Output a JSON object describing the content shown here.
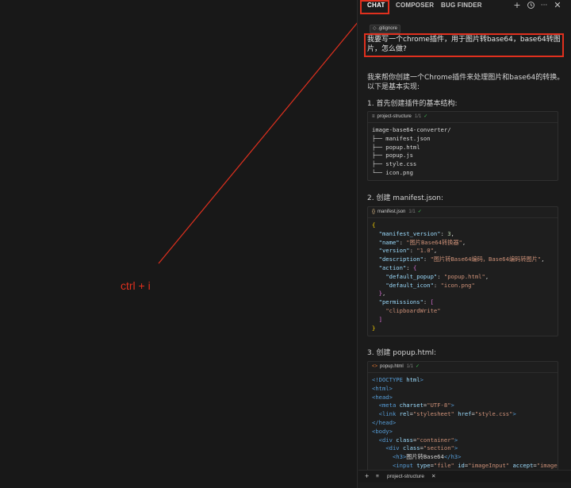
{
  "annotation": {
    "shortcut_label": "ctrl + i",
    "color": "#e0301e"
  },
  "topbar": {
    "tabs": [
      "CHAT",
      "COMPOSER",
      "BUG FINDER"
    ],
    "icons": [
      "plus-icon",
      "history-icon",
      "more-icon",
      "close-icon"
    ]
  },
  "context_chip": {
    "icon": "diamond-icon",
    "label": ".gitignore"
  },
  "user_message": "我要写一个chrome插件，用于图片转base64，base64转图片，怎么做?",
  "assistant": {
    "intro": "我来帮你创建一个Chrome插件来处理图片和base64的转换。以下是基本实现:",
    "steps": [
      "1. 首先创建插件的基本结构:",
      "2. 创建 manifest.json:",
      "3. 创建 popup.html:"
    ],
    "blocks": [
      {
        "file": "project-structure",
        "version": "1/1",
        "icon": "list-icon"
      },
      {
        "file": "manifest.json",
        "version": "1/1",
        "icon": "braces-icon"
      },
      {
        "file": "popup.html",
        "version": "1/1",
        "icon": "html-icon"
      }
    ]
  },
  "bottom_bar": {
    "tab_label": "project-structure",
    "add_label": "+"
  }
}
